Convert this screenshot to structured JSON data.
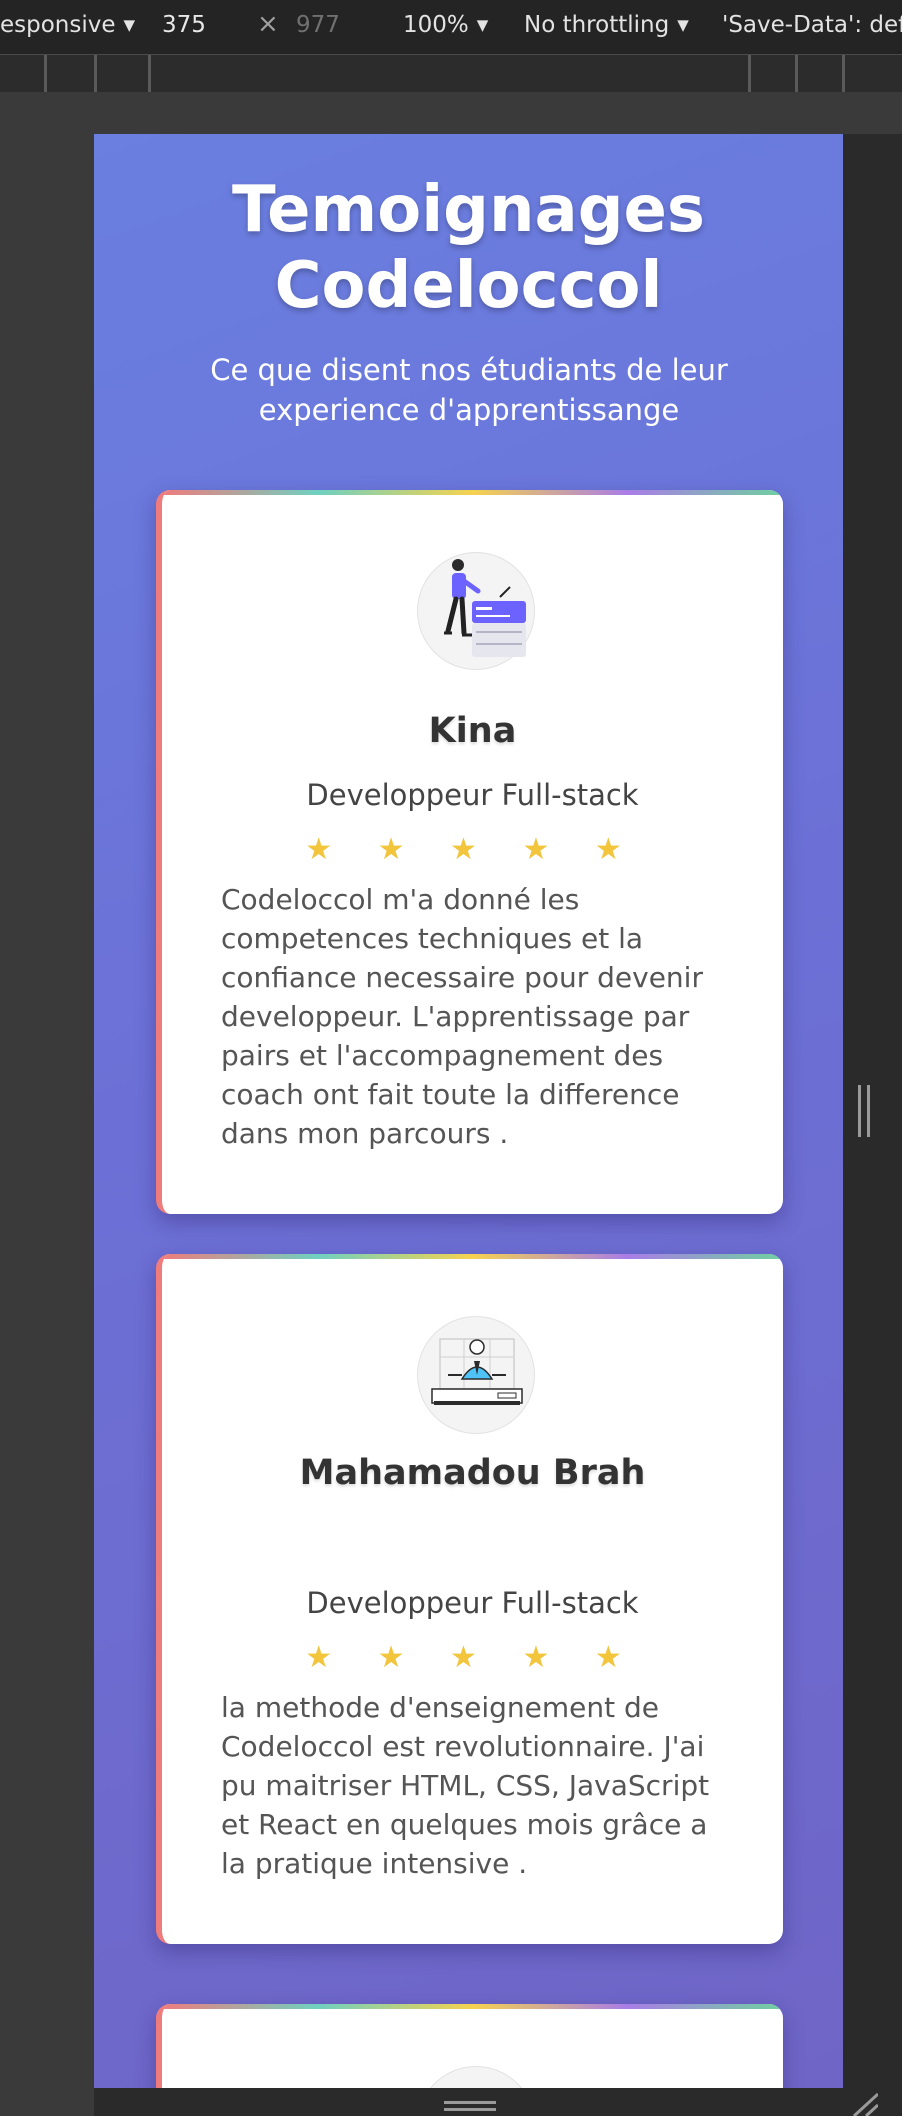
{
  "devtools": {
    "device_label": "esponsive",
    "width": "375",
    "height_placeholder": "977",
    "zoom": "100%",
    "throttling": "No throttling",
    "save_data": "'Save-Data': def"
  },
  "page": {
    "title_line1": "Temoignages",
    "title_line2": "Codeloccol",
    "subtitle": "Ce que disent nos étudiants de leur experience d'apprentissange"
  },
  "testimonials": [
    {
      "name": "Kina",
      "role": "Developpeur Full-stack",
      "stars": "★ ★ ★ ★ ★",
      "rating": 5,
      "quote": "Codeloccol m'a donné les competences techniques et la confiance necessaire pour devenir developpeur. L'apprentissage par pairs et l'accompagnement des coach ont fait toute la difference dans mon parcours ."
    },
    {
      "name": "Mahamadou Brah",
      "role": "Developpeur Full-stack",
      "stars": "★ ★ ★ ★ ★",
      "rating": 5,
      "quote": "la methode d'enseignement de Codeloccol est revolutionnaire. J'ai pu maitriser HTML, CSS, JavaScript et React en quelques mois grâce a la pratique intensive ."
    }
  ],
  "colors": {
    "page_gradient_start": "#6a7fe0",
    "page_gradient_end": "#6f65c6",
    "card_left_border": "#ef7c7c",
    "star": "#f2c53d"
  }
}
